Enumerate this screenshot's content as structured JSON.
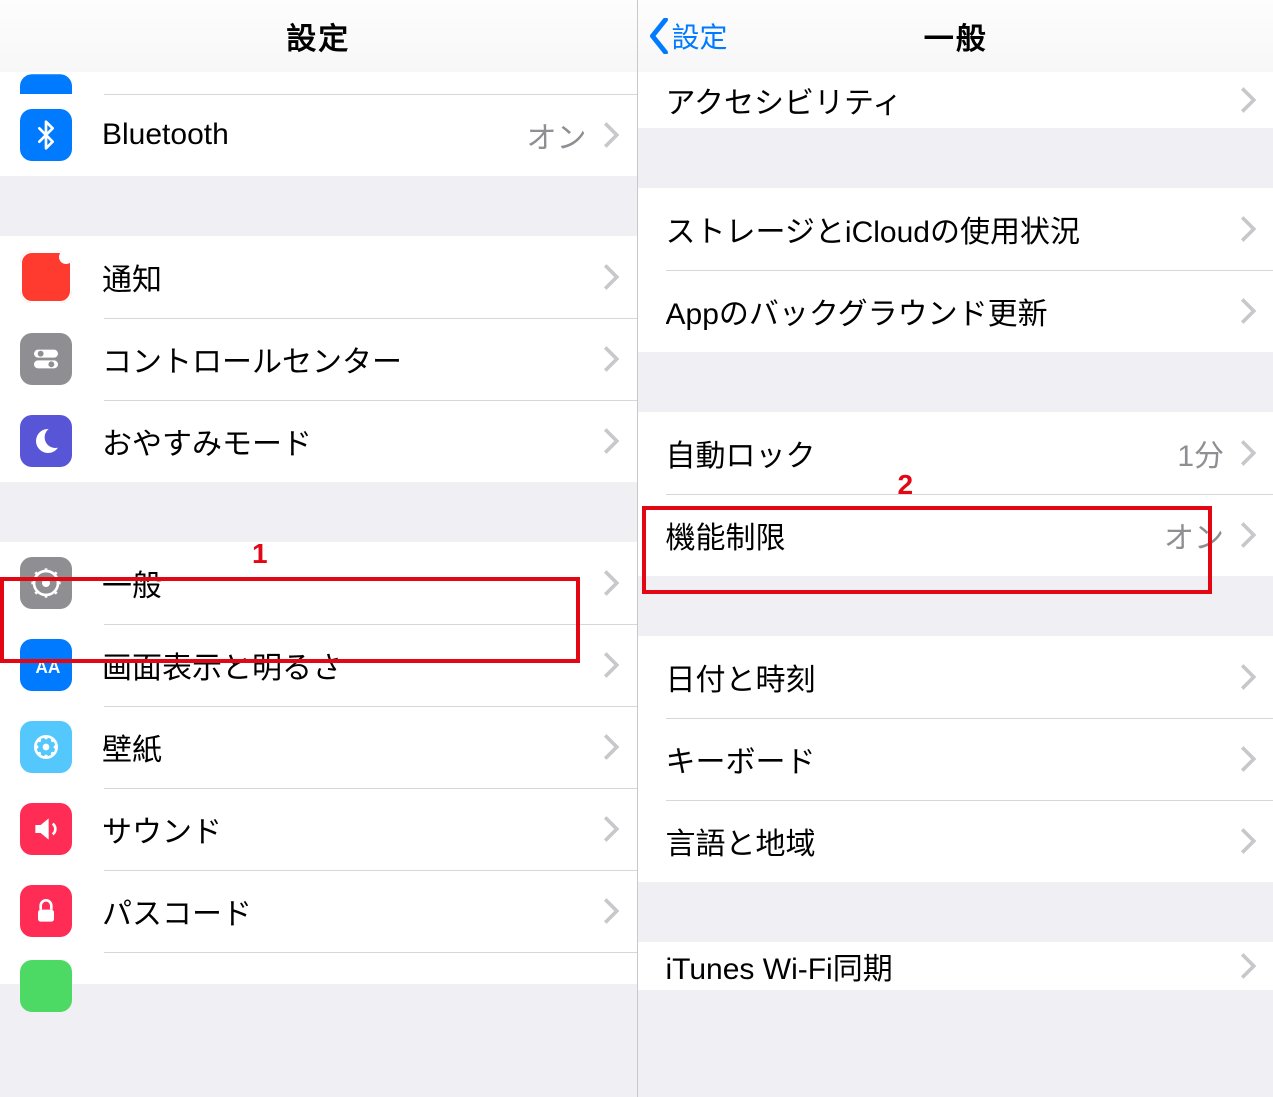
{
  "left": {
    "nav_title": "設定",
    "row_bluetooth": {
      "label": "Bluetooth",
      "value": "オン"
    },
    "row_notifications": {
      "label": "通知"
    },
    "row_control_center": {
      "label": "コントロールセンター"
    },
    "row_dnd": {
      "label": "おやすみモード"
    },
    "row_general": {
      "label": "一般"
    },
    "row_display": {
      "label": "画面表示と明るさ"
    },
    "row_wallpaper": {
      "label": "壁紙"
    },
    "row_sounds": {
      "label": "サウンド"
    },
    "row_passcode": {
      "label": "パスコード"
    }
  },
  "right": {
    "nav_back": "設定",
    "nav_title": "一般",
    "row_accessibility": {
      "label": "アクセシビリティ"
    },
    "row_storage": {
      "label": "ストレージとiCloudの使用状況"
    },
    "row_bg_refresh": {
      "label": "Appのバックグラウンド更新"
    },
    "row_autolock": {
      "label": "自動ロック",
      "value": "1分"
    },
    "row_restrictions": {
      "label": "機能制限",
      "value": "オン"
    },
    "row_datetime": {
      "label": "日付と時刻"
    },
    "row_keyboard": {
      "label": "キーボード"
    },
    "row_language": {
      "label": "言語と地域"
    },
    "row_itunes": {
      "label": "iTunes Wi-Fi同期"
    }
  },
  "annotations": {
    "badge1": "1",
    "badge2": "2"
  }
}
